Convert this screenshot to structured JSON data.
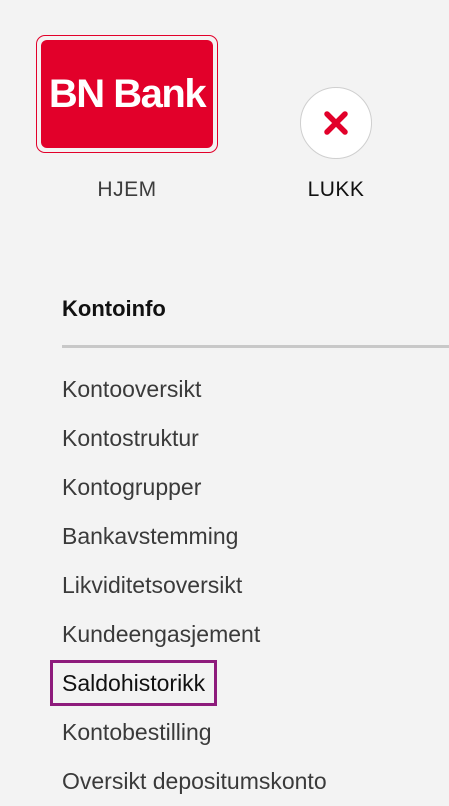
{
  "header": {
    "logo_text": "BN Bank",
    "home_label": "HJEM",
    "close_label": "LUKK",
    "close_icon": "x-icon"
  },
  "section": {
    "title": "Kontoinfo"
  },
  "menu": {
    "items": [
      {
        "label": "Kontooversikt",
        "active": false
      },
      {
        "label": "Kontostruktur",
        "active": false
      },
      {
        "label": "Kontogrupper",
        "active": false
      },
      {
        "label": "Bankavstemming",
        "active": false
      },
      {
        "label": "Likviditetsoversikt",
        "active": false
      },
      {
        "label": "Kundeengasjement",
        "active": false
      },
      {
        "label": "Saldohistorikk",
        "active": true
      },
      {
        "label": "Kontobestilling",
        "active": false
      },
      {
        "label": "Oversikt depositumskonto",
        "active": false
      }
    ]
  },
  "colors": {
    "brand": "#e2002a",
    "highlight": "#8e1b7c",
    "background": "#f3f3f3"
  }
}
